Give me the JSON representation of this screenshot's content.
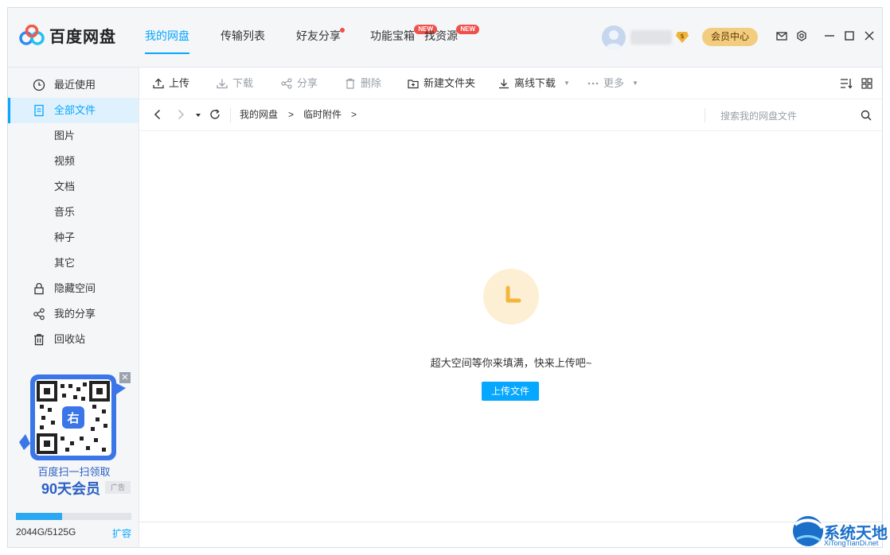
{
  "app": {
    "name": "百度网盘"
  },
  "nav": {
    "items": [
      {
        "label": "我的网盘",
        "active": true
      },
      {
        "label": "传输列表"
      },
      {
        "label": "好友分享",
        "dot": true
      },
      {
        "label": "功能宝箱",
        "badge": "NEW"
      },
      {
        "label": "找资源",
        "badge": "NEW"
      }
    ]
  },
  "header": {
    "vip_button": "会员中心",
    "vip_gem": "$"
  },
  "sidebar": {
    "items": [
      {
        "label": "最近使用",
        "icon": "clock-icon"
      },
      {
        "label": "全部文件",
        "icon": "file-icon",
        "active": true
      },
      {
        "label": "图片"
      },
      {
        "label": "视频"
      },
      {
        "label": "文档"
      },
      {
        "label": "音乐"
      },
      {
        "label": "种子"
      },
      {
        "label": "其它"
      },
      {
        "label": "隐藏空间",
        "icon": "lock-icon"
      },
      {
        "label": "我的分享",
        "icon": "share-icon"
      },
      {
        "label": "回收站",
        "icon": "trash-icon"
      }
    ],
    "ad": {
      "line1": "百度扫一扫领取",
      "line2": "90天会员",
      "tag": "广告",
      "qr_logo": "右",
      "close": "✕"
    },
    "storage": {
      "text": "2044G/5125G",
      "expand": "扩容",
      "used": 2044,
      "total": 5125
    }
  },
  "toolbar": {
    "upload": "上传",
    "download": "下载",
    "share": "分享",
    "delete": "删除",
    "new_folder": "新建文件夹",
    "offline_download": "离线下载",
    "more": "更多"
  },
  "address": {
    "crumbs": [
      "我的网盘",
      "临时附件"
    ],
    "separator": ">",
    "search_placeholder": "搜索我的网盘文件"
  },
  "empty": {
    "message": "超大空间等你来填满，快来上传吧~",
    "upload_button": "上传文件"
  },
  "watermark": {
    "line1": "系统天地",
    "line2": "XiTongTianDi.net"
  },
  "colors": {
    "accent": "#06a7ff",
    "vip": "#f3cd7f",
    "badge": "#f0504b"
  }
}
